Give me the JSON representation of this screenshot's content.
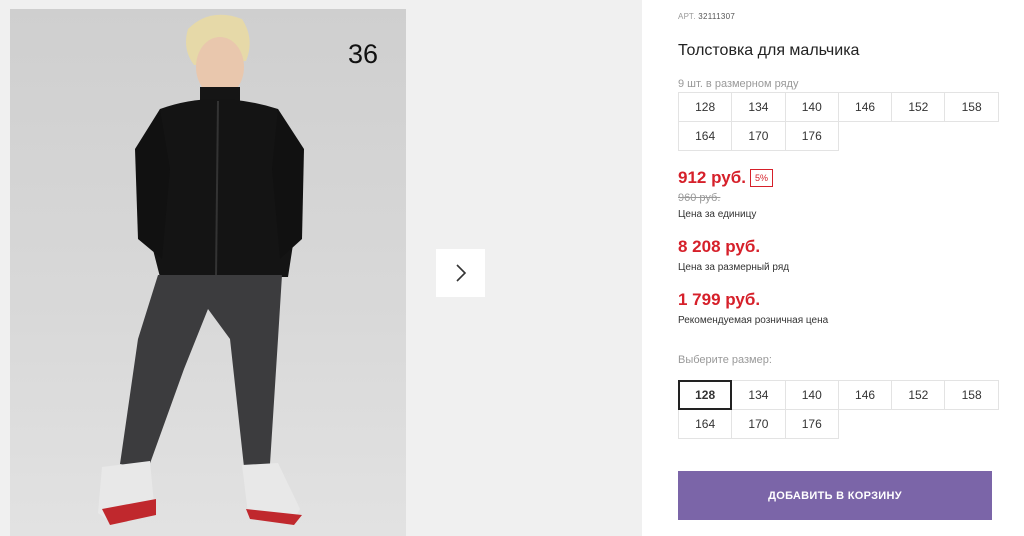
{
  "gallery": {
    "photo_number": "36",
    "next_icon": "chevron-right-icon"
  },
  "product": {
    "article_label": "АРТ.",
    "article_value": "32111307",
    "title": "Толстовка для мальчика",
    "row_count_text": "9 шт. в размерном ряду",
    "row_sizes": [
      "128",
      "134",
      "140",
      "146",
      "152",
      "158",
      "164",
      "170",
      "176"
    ]
  },
  "pricing": {
    "unit_price": "912 руб.",
    "discount_badge": "5%",
    "old_price": "960 руб.",
    "unit_caption": "Цена за единицу",
    "row_price": "8 208 руб.",
    "row_caption": "Цена за размерный ряд",
    "rrp_price": "1 799 руб.",
    "rrp_caption": "Рекомендуемая розничная цена",
    "accent_color": "#d6202a"
  },
  "size_select": {
    "label": "Выберите размер:",
    "options": [
      "128",
      "134",
      "140",
      "146",
      "152",
      "158",
      "164",
      "170",
      "176"
    ],
    "selected": "128"
  },
  "cart": {
    "button_label": "ДОБАВИТЬ В КОРЗИНУ",
    "button_color": "#7b65a8"
  }
}
